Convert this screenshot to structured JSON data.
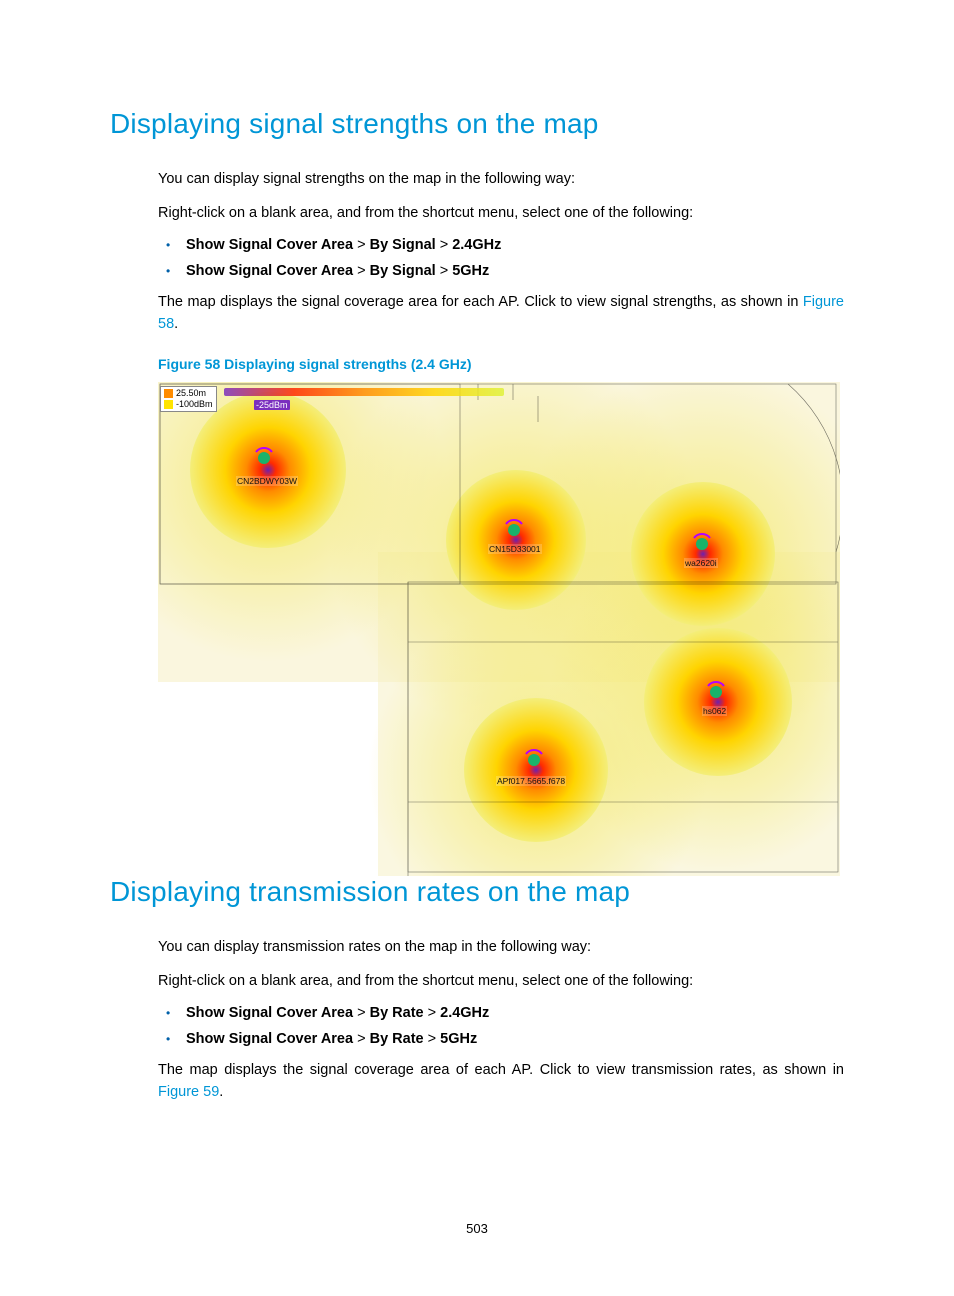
{
  "page_number": "503",
  "section1": {
    "title": "Displaying signal strengths on the map",
    "intro": "You can display signal strengths on the map in the following way:",
    "instruct": "Right-click on a blank area, and from the shortcut menu, select one of the following:",
    "menu_prefix": "Show Signal Cover Area",
    "menu_mid": "By Signal",
    "opt1": "2.4GHz",
    "opt2": "5GHz",
    "gt": ">",
    "result_a": "The map displays the signal coverage area for each AP. Click to view signal strengths, as shown in ",
    "result_link": "Figure 58",
    "result_b": ".",
    "figcap": "Figure 58 Displaying signal strengths (2.4 GHz)"
  },
  "figure": {
    "legend_top": "25.50m",
    "legend_bot": "-100dBm",
    "slider_val": "-25dBm",
    "ap1": "CN2BDWY03W",
    "ap2": "CN15D33001",
    "ap3": "wa2620i",
    "ap4": "hs062",
    "ap5": "APf017.5665.f678"
  },
  "section2": {
    "title": "Displaying transmission rates on the map",
    "intro": "You can display transmission rates on the map in the following way:",
    "instruct": "Right-click on a blank area, and from the shortcut menu, select one of the following:",
    "menu_prefix": "Show Signal Cover Area",
    "menu_mid": "By Rate",
    "opt1": "2.4GHz",
    "opt2": "5GHz",
    "gt": ">",
    "result_a": "The map displays the signal coverage area of each AP. Click to view transmission rates, as shown in ",
    "result_link": "Figure 59",
    "result_b": "."
  }
}
